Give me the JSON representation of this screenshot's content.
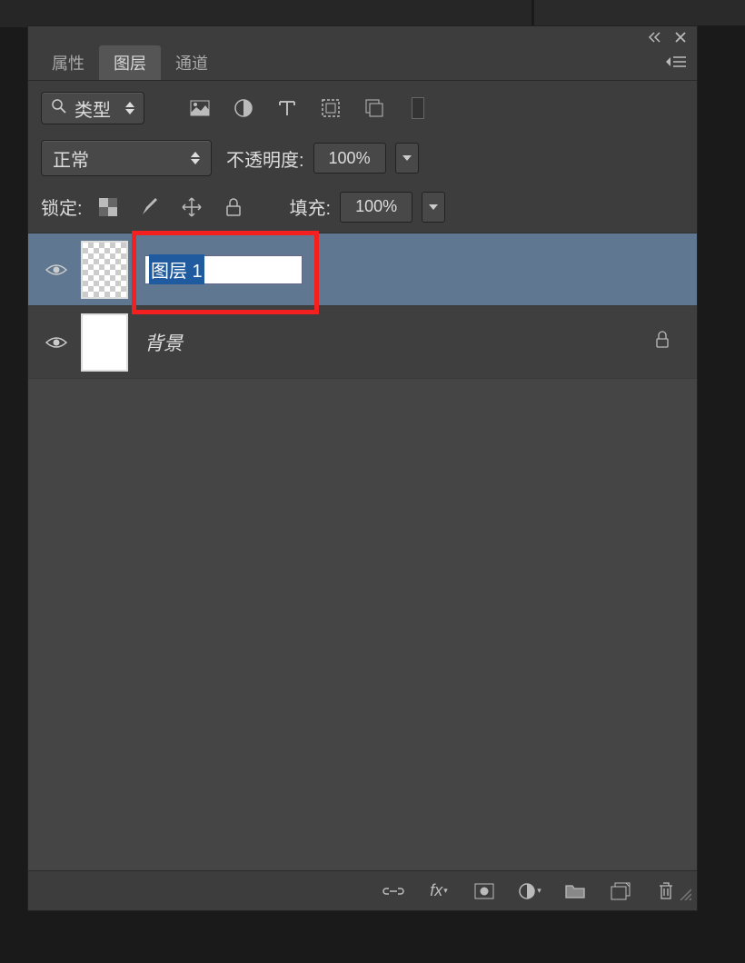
{
  "header": {
    "tabs": [
      {
        "label": "属性",
        "active": false
      },
      {
        "label": "图层",
        "active": true
      },
      {
        "label": "通道",
        "active": false
      }
    ]
  },
  "filter": {
    "label": "类型"
  },
  "blend": {
    "mode": "正常",
    "opacity_label": "不透明度:",
    "opacity_value": "100%"
  },
  "lock": {
    "label": "锁定:",
    "fill_label": "填充:",
    "fill_value": "100%"
  },
  "layers": [
    {
      "name": "图层 1",
      "visible": true,
      "selected": true,
      "editing": true,
      "thumb": "transparent"
    },
    {
      "name": "背景",
      "visible": true,
      "selected": false,
      "editing": false,
      "locked": true,
      "thumb": "white"
    }
  ],
  "icons": {
    "pixel_filter": "pixel",
    "adjust_filter": "adjust",
    "type_filter": "type",
    "shape_filter": "shape",
    "smart_filter": "smart"
  }
}
